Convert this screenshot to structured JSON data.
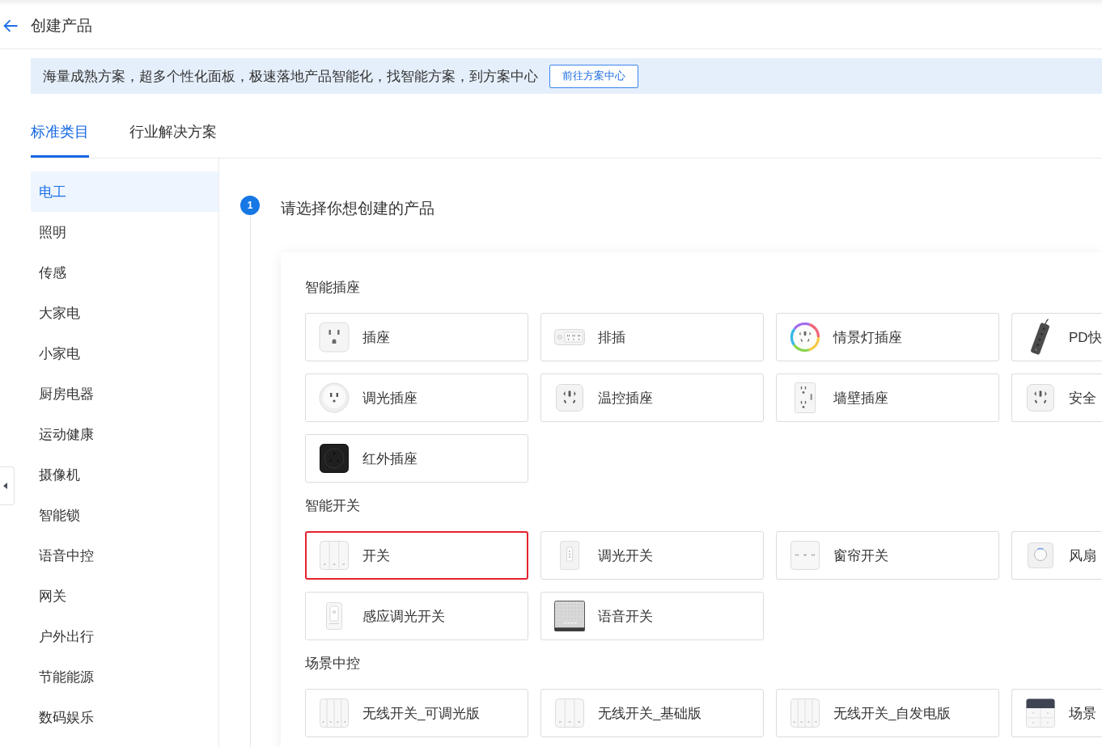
{
  "header": {
    "title": "创建产品"
  },
  "banner": {
    "text": "海量成熟方案，超多个性化面板，极速落地产品智能化，找智能方案，到方案中心",
    "button": "前往方案中心"
  },
  "tabs": [
    {
      "label": "标准类目",
      "selected": true
    },
    {
      "label": "行业解决方案",
      "selected": false
    }
  ],
  "sidebar": {
    "items": [
      {
        "label": "电工",
        "selected": true
      },
      {
        "label": "照明",
        "selected": false
      },
      {
        "label": "传感",
        "selected": false
      },
      {
        "label": "大家电",
        "selected": false
      },
      {
        "label": "小家电",
        "selected": false
      },
      {
        "label": "厨房电器",
        "selected": false
      },
      {
        "label": "运动健康",
        "selected": false
      },
      {
        "label": "摄像机",
        "selected": false
      },
      {
        "label": "智能锁",
        "selected": false
      },
      {
        "label": "语音中控",
        "selected": false
      },
      {
        "label": "网关",
        "selected": false
      },
      {
        "label": "户外出行",
        "selected": false
      },
      {
        "label": "节能能源",
        "selected": false
      },
      {
        "label": "数码娱乐",
        "selected": false
      }
    ]
  },
  "step": {
    "number": "1",
    "title": "请选择你想创建的产品"
  },
  "sections": [
    {
      "title": "智能插座",
      "products": [
        {
          "label": "插座",
          "kind": "socket",
          "selected": false
        },
        {
          "label": "排插",
          "kind": "strip",
          "selected": false
        },
        {
          "label": "情景灯插座",
          "kind": "ringsocket",
          "selected": false
        },
        {
          "label": "PD快",
          "kind": "cordstrip",
          "selected": false
        },
        {
          "label": "调光插座",
          "kind": "roundsocket",
          "selected": false
        },
        {
          "label": "温控插座",
          "kind": "cnsocket",
          "selected": false
        },
        {
          "label": "墙壁插座",
          "kind": "wallsocket",
          "selected": false
        },
        {
          "label": "安全",
          "kind": "cnsocket",
          "selected": false
        },
        {
          "label": "红外插座",
          "kind": "darksocket",
          "selected": false
        }
      ]
    },
    {
      "title": "智能开关",
      "products": [
        {
          "label": "开关",
          "kind": "switch3",
          "selected": true
        },
        {
          "label": "调光开关",
          "kind": "dimmer",
          "selected": false
        },
        {
          "label": "窗帘开关",
          "kind": "curtain",
          "selected": false
        },
        {
          "label": "风扇",
          "kind": "knob",
          "selected": false
        },
        {
          "label": "感应调光开关",
          "kind": "sensor",
          "selected": false
        },
        {
          "label": "语音开关",
          "kind": "voice",
          "selected": false
        }
      ]
    },
    {
      "title": "场景中控",
      "products": [
        {
          "label": "无线开关_可调光版",
          "kind": "switch4",
          "selected": false
        },
        {
          "label": "无线开关_基础版",
          "kind": "switch3",
          "selected": false
        },
        {
          "label": "无线开关_自发电版",
          "kind": "switch4",
          "selected": false
        },
        {
          "label": "场景",
          "kind": "scene",
          "selected": false
        }
      ]
    }
  ]
}
